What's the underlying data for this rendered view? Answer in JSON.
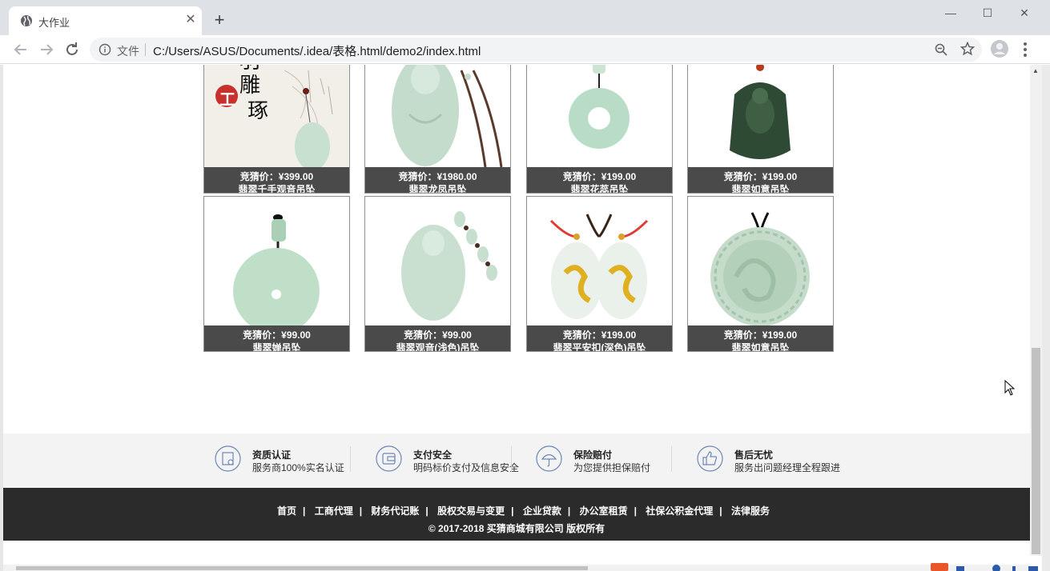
{
  "browser": {
    "tab_title": "大作业",
    "tab_close": "✕",
    "new_tab": "+",
    "window_controls": {
      "minimize": "—",
      "maximize": "☐",
      "close": "✕"
    },
    "scheme_label": "文件",
    "url": "C:/Users/ASUS/Documents/.idea/表格.html/demo2/index.html"
  },
  "products_row1": [
    {
      "price": "竞猜价：¥399.00",
      "name": "翡翠千手观音吊坠"
    },
    {
      "price": "竞猜价：¥1980.00",
      "name": "翡翠龙凤吊坠"
    },
    {
      "price": "竞猜价：¥199.00",
      "name": "翡翠花蕊吊坠"
    },
    {
      "price": "竞猜价：¥199.00",
      "name": "翡翠如意吊坠"
    }
  ],
  "products_row2": [
    {
      "price": "竞猜价：¥99.00",
      "name": "翡翠婵吊坠"
    },
    {
      "price": "竞猜价：¥99.00",
      "name": "翡翠观音(浅色)吊坠"
    },
    {
      "price": "竞猜价：¥199.00",
      "name": "翡翠平安扣(深色)吊坠"
    },
    {
      "price": "竞猜价：¥199.00",
      "name": "翡翠如意吊坠"
    }
  ],
  "product1_stamp": {
    "line1": "羽",
    "line2": "雕",
    "seal": "工",
    "line3": "琢"
  },
  "features": [
    {
      "title": "资质认证",
      "desc": "服务商100%实名认证",
      "icon": "certificate-icon"
    },
    {
      "title": "支付安全",
      "desc": "明码标价支付及信息安全",
      "icon": "wallet-icon"
    },
    {
      "title": "保险赔付",
      "desc": "为您提供担保赔付",
      "icon": "umbrella-icon"
    },
    {
      "title": "售后无忧",
      "desc": "服务出问题经理全程跟进",
      "icon": "thumbs-up-icon"
    }
  ],
  "footer": {
    "links": [
      "首页",
      "工商代理",
      "财务代记账",
      "股权交易与变更",
      "企业贷款",
      "办公室租赁",
      "社保公积金代理",
      "法律服务"
    ],
    "separator": "|",
    "copyright": "© 2017-2018 买猜商城有限公司 版权所有"
  },
  "colors": {
    "caption_bg": "#4a4a4a",
    "features_bg": "#f3f3f3",
    "footer_bg": "#2b2b2b",
    "jade_light": "#b9dcc6",
    "jade_dark": "#2f4a34"
  }
}
